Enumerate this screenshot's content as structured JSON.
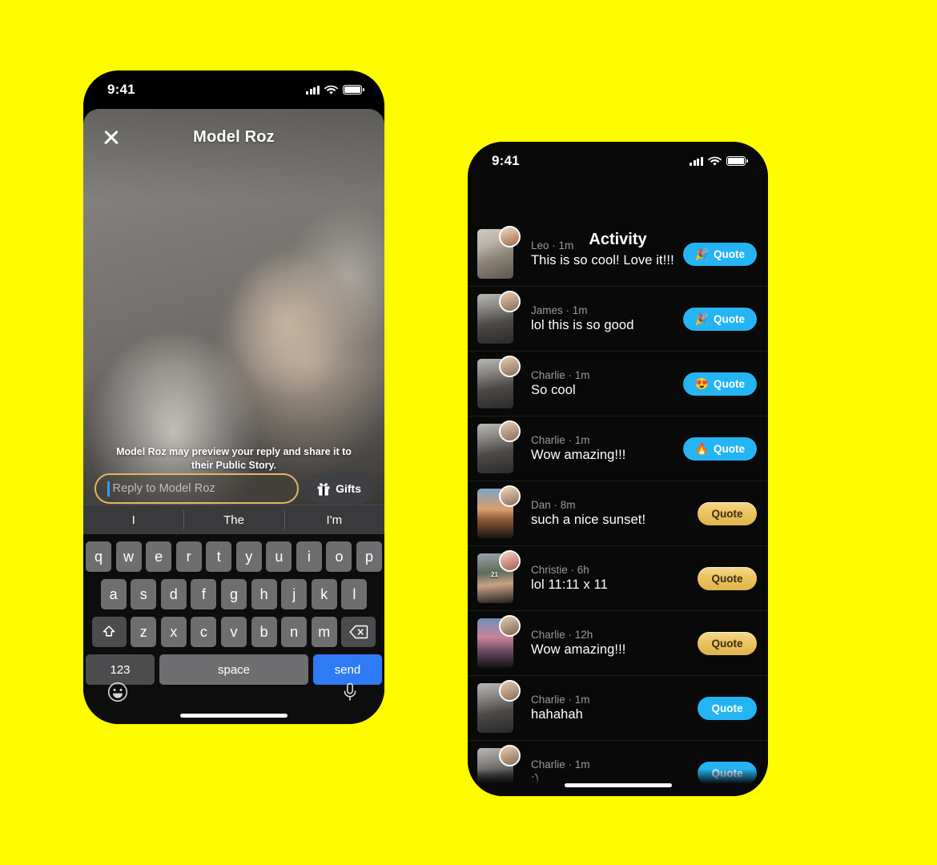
{
  "canvas": {
    "background_color": "#FFFC00"
  },
  "phone_left": {
    "name": "story-reply-screen",
    "status_bar": {
      "time": "9:41",
      "signal_icon": "cellular-bars-icon",
      "wifi_icon": "wifi-icon",
      "battery_icon": "battery-full-icon"
    },
    "header": {
      "close_icon": "close-x-icon",
      "title": "Model Roz"
    },
    "preview_note": "Model Roz may preview your reply and share it to their Public Story.",
    "reply": {
      "placeholder": "Reply to Model Roz",
      "value": ""
    },
    "gifts_button": {
      "label": "Gifts",
      "icon": "gift-icon"
    },
    "keyboard": {
      "suggestions": [
        "I",
        "The",
        "I'm"
      ],
      "row1": [
        "q",
        "w",
        "e",
        "r",
        "t",
        "y",
        "u",
        "i",
        "o",
        "p"
      ],
      "row2": [
        "a",
        "s",
        "d",
        "f",
        "g",
        "h",
        "j",
        "k",
        "l"
      ],
      "row3": [
        "z",
        "x",
        "c",
        "v",
        "b",
        "n",
        "m"
      ],
      "shift_icon": "shift-arrow-icon",
      "backspace_icon": "backspace-icon",
      "numbers_label": "123",
      "space_label": "space",
      "send_label": "send",
      "emoji_icon": "emoji-smiley-icon",
      "mic_icon": "microphone-icon"
    },
    "home_indicator": "home-indicator"
  },
  "phone_right": {
    "name": "activity-screen",
    "status_bar": {
      "time": "9:41",
      "signal_icon": "cellular-bars-icon",
      "wifi_icon": "wifi-icon",
      "battery_icon": "battery-full-icon"
    },
    "header": {
      "back_icon": "back-chevron-icon",
      "title": "Activity"
    },
    "rows": [
      {
        "user": "Leo",
        "time": "1m",
        "message": "This is so cool! Love it!!!",
        "quote_label": "Quote",
        "quote_style": "blue",
        "emoji": "🎉",
        "thumb": "statue-photo",
        "badge": ""
      },
      {
        "user": "James",
        "time": "1m",
        "message": "lol this is so good",
        "quote_label": "Quote",
        "quote_style": "blue",
        "emoji": "🎉",
        "thumb": "selfie-photo",
        "badge": ""
      },
      {
        "user": "Charlie",
        "time": "1m",
        "message": "So cool",
        "quote_label": "Quote",
        "quote_style": "blue",
        "emoji": "😍",
        "thumb": "selfie-photo",
        "badge": ""
      },
      {
        "user": "Charlie",
        "time": "1m",
        "message": "Wow amazing!!!",
        "quote_label": "Quote",
        "quote_style": "blue",
        "emoji": "🔥",
        "thumb": "selfie-photo",
        "badge": ""
      },
      {
        "user": "Dan",
        "time": "8m",
        "message": "such a nice sunset!",
        "quote_label": "Quote",
        "quote_style": "gold",
        "emoji": "",
        "thumb": "sunset-photo",
        "badge": ""
      },
      {
        "user": "Christie",
        "time": "6h",
        "message": "lol 11:11 x 11",
        "quote_label": "Quote",
        "quote_style": "gold",
        "emoji": "",
        "thumb": "portrait-photo",
        "badge": "21"
      },
      {
        "user": "Charlie",
        "time": "12h",
        "message": "Wow amazing!!!",
        "quote_label": "Quote",
        "quote_style": "gold",
        "emoji": "",
        "thumb": "palms-photo",
        "badge": ""
      },
      {
        "user": "Charlie",
        "time": "1m",
        "message": "hahahah",
        "quote_label": "Quote",
        "quote_style": "blue",
        "emoji": "",
        "thumb": "selfie-photo",
        "badge": ""
      },
      {
        "user": "Charlie",
        "time": "1m",
        "message": ":)",
        "quote_label": "Quote",
        "quote_style": "blue",
        "emoji": "",
        "thumb": "selfie-photo",
        "badge": ""
      }
    ],
    "home_indicator": "home-indicator"
  },
  "colors": {
    "brand_yellow": "#FFFC00",
    "quote_blue": "#24B4F4",
    "quote_gold": "#EBC35F",
    "send_blue": "#2F7BF6",
    "input_border_gold": "#E3B660"
  }
}
